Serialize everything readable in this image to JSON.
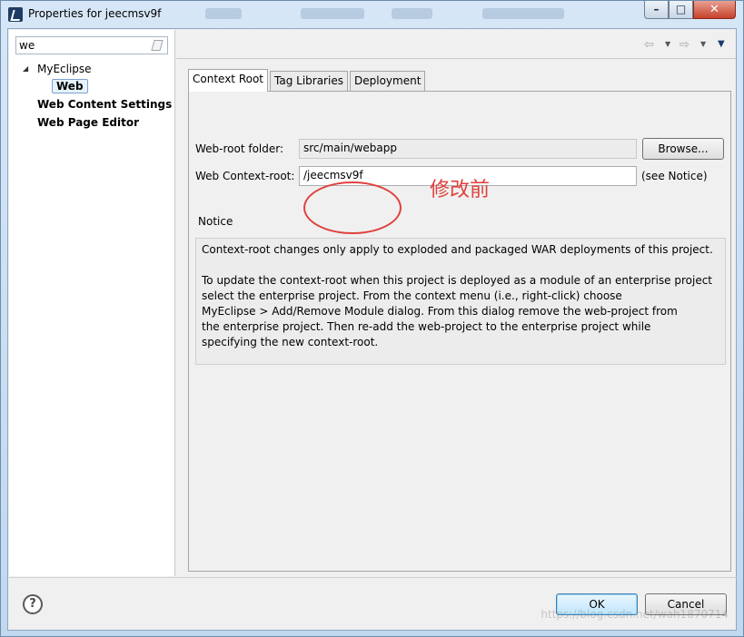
{
  "window": {
    "title": "Properties for jeecmsv9f",
    "min_glyph": "–",
    "max_glyph": "□",
    "close_glyph": "✕"
  },
  "filter": {
    "value": "we"
  },
  "tree": {
    "group": "MyEclipse",
    "selected_item": "Web",
    "items": [
      "Web Content Settings",
      "Web Page Editor"
    ],
    "expander_glyph": "◢"
  },
  "nav": {
    "back_glyph": "⇦",
    "forward_glyph": "⇨",
    "caret_glyph": "▼"
  },
  "tabs": [
    "Context Root",
    "Tag Libraries",
    "Deployment"
  ],
  "form": {
    "web_root_label": "Web-root folder:",
    "web_root_value": "src/main/webapp",
    "browse_label": "Browse...",
    "context_root_label": "Web Context-root:",
    "context_root_value": "/jeecmsv9f",
    "see_notice": "(see Notice)"
  },
  "annotation": {
    "text": "修改前",
    "color": "#e0403c"
  },
  "notice": {
    "title": "Notice",
    "lines": [
      "Context-root changes only apply to exploded and packaged WAR deployments of this project.",
      "",
      "To update the context-root when this project is deployed as a module of an enterprise project",
      "select the enterprise project. From the context menu (i.e., right-click) choose",
      "MyEclipse > Add/Remove Module dialog. From this dialog remove the web-project from",
      "the enterprise project. Then re-add the web-project to the enterprise project while",
      "specifying the new context-root."
    ]
  },
  "footer": {
    "help_glyph": "?",
    "ok_label": "OK",
    "cancel_label": "Cancel",
    "watermark": "https://blog.csdn.net/wah1870714"
  }
}
